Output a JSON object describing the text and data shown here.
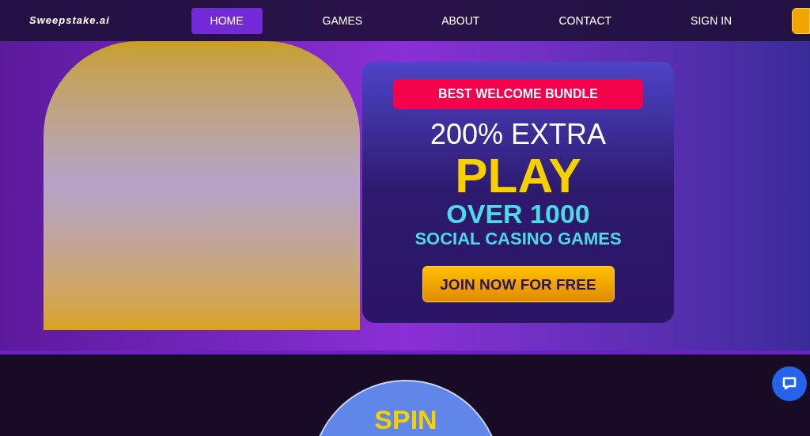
{
  "brand": "Sweepstake.ai",
  "nav": [
    {
      "label": "HOME",
      "selected": true
    },
    {
      "label": "GAMES",
      "selected": false
    },
    {
      "label": "ABOUT",
      "selected": false
    },
    {
      "label": "CONTACT",
      "selected": false
    },
    {
      "label": "SIGN IN",
      "selected": false
    }
  ],
  "hero": {
    "badge": "BEST WELCOME BUNDLE",
    "line_1": "200% EXTRA",
    "line_2": "PLAY",
    "line_3": "OVER 1000",
    "line_4": "SOCIAL CASINO GAMES",
    "cta": "JOIN NOW FOR FREE"
  },
  "wheel": {
    "label": "SPIN"
  }
}
